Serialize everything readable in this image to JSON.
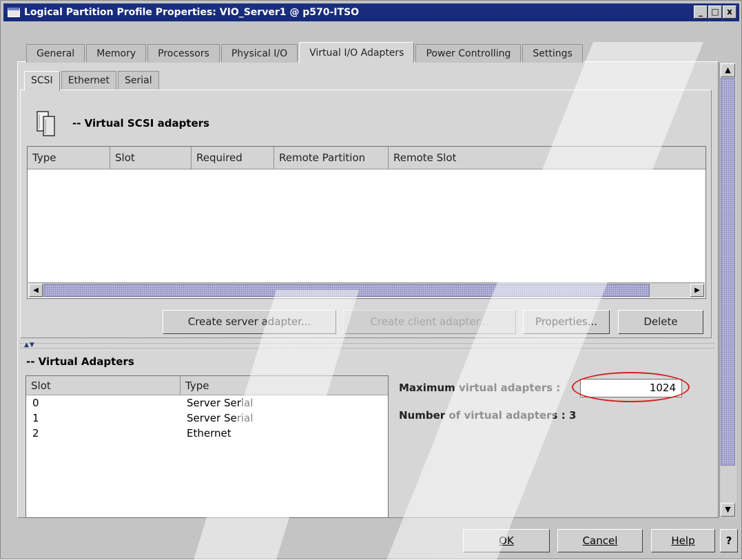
{
  "window": {
    "title": "Logical Partition Profile Properties: VIO_Server1 @ p570-ITSO",
    "controls": {
      "minimize": "_",
      "maximize": "□",
      "close": "x"
    }
  },
  "tabs": [
    "General",
    "Memory",
    "Processors",
    "Physical I/O",
    "Virtual I/O Adapters",
    "Power Controlling",
    "Settings"
  ],
  "active_tab": "Virtual I/O Adapters",
  "subtabs": [
    "SCSI",
    "Ethernet",
    "Serial"
  ],
  "active_subtab": "SCSI",
  "scsi_section": {
    "heading": "-- Virtual SCSI adapters",
    "columns": [
      "Type",
      "Slot",
      "Required",
      "Remote Partition",
      "Remote Slot"
    ],
    "rows": []
  },
  "buttons": {
    "create_server": "Create server adapter...",
    "create_client": "Create client adapter...",
    "properties": "Properties...",
    "delete": "Delete"
  },
  "virtual_adapters": {
    "heading": "-- Virtual Adapters",
    "columns": [
      "Slot",
      "Type"
    ],
    "rows": [
      {
        "slot": "0",
        "type": "Server Serial"
      },
      {
        "slot": "1",
        "type": "Server Serial"
      },
      {
        "slot": "2",
        "type": "Ethernet"
      }
    ],
    "max_label": "Maximum virtual adapters :",
    "max_value": "1024",
    "count_label": "Number of virtual adapters :",
    "count_value": "3"
  },
  "footer": {
    "ok": "OK",
    "cancel": "Cancel",
    "help": "Help",
    "question": "?"
  },
  "colors": {
    "titlebar": "#1a2f80",
    "highlight_ellipse": "#d42020",
    "scroll_thumb": "#b8b8d8"
  }
}
